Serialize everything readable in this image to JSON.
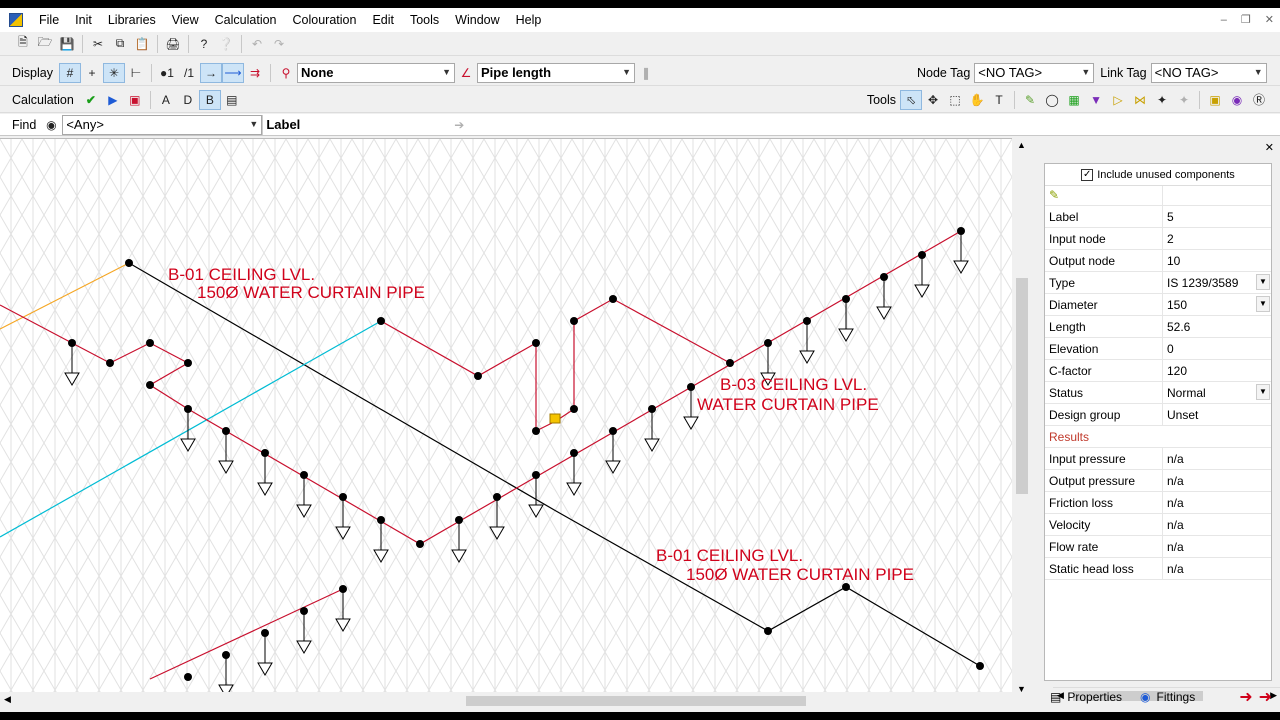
{
  "menu": [
    "File",
    "Init",
    "Libraries",
    "View",
    "Calculation",
    "Colouration",
    "Edit",
    "Tools",
    "Window",
    "Help"
  ],
  "toolbar2": {
    "display_label": "Display",
    "node_colour_value": "None",
    "link_colour_value": "Pipe length",
    "node_tag_label": "Node Tag",
    "node_tag_value": "<NO TAG>",
    "link_tag_label": "Link Tag",
    "link_tag_value": "<NO TAG>"
  },
  "toolbar3": {
    "calculation_label": "Calculation",
    "a_label": "A",
    "d_label": "D",
    "b_label": "B",
    "tools_label": "Tools"
  },
  "find": {
    "label": "Find",
    "value": "<Any>",
    "field": "Label"
  },
  "canvas": {
    "annotations": [
      {
        "line1": "B-01 CEILING LVL.",
        "line2": "150Ø WATER CURTAIN PIPE"
      },
      {
        "line1": "B-03 CEILING LVL.",
        "line2": "WATER CURTAIN PIPE"
      },
      {
        "line1": "B-01 CEILING LVL.",
        "line2": "150Ø WATER CURTAIN PIPE"
      }
    ]
  },
  "properties": {
    "include_unused": "Include unused components",
    "rows": [
      {
        "key": "Label",
        "value": "5"
      },
      {
        "key": "Input node",
        "value": "2"
      },
      {
        "key": "Output node",
        "value": "10"
      },
      {
        "key": "Type",
        "value": "IS 1239/3589"
      },
      {
        "key": "Diameter",
        "value": "150"
      },
      {
        "key": "Length",
        "value": "52.6"
      },
      {
        "key": "Elevation",
        "value": "0"
      },
      {
        "key": "C-factor",
        "value": "120"
      },
      {
        "key": "Status",
        "value": "Normal"
      },
      {
        "key": "Design group",
        "value": "Unset"
      }
    ],
    "results_header": "Results",
    "results": [
      {
        "key": "Input pressure",
        "value": "n/a"
      },
      {
        "key": "Output pressure",
        "value": "n/a"
      },
      {
        "key": "Friction loss",
        "value": "n/a"
      },
      {
        "key": "Velocity",
        "value": "n/a"
      },
      {
        "key": "Flow rate",
        "value": "n/a"
      },
      {
        "key": "Static head loss",
        "value": "n/a"
      }
    ],
    "tab_properties": "Properties",
    "tab_fittings": "Fittings"
  },
  "colors": {
    "annotation_red": "#d0021b",
    "pipe_red": "#c8102e",
    "pipe_black": "#000000",
    "grid": "#dedede",
    "cyan": "#00bcd4",
    "orange": "#f5a623"
  }
}
